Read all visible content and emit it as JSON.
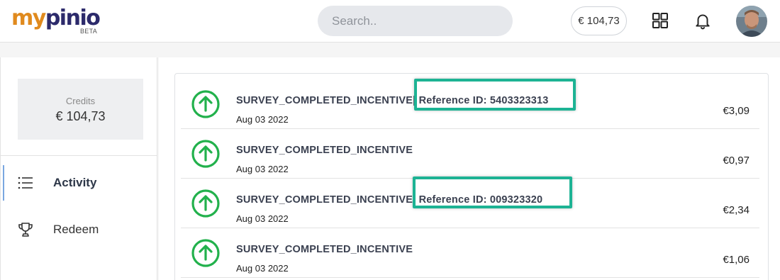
{
  "brand": {
    "logo_part1": "my",
    "logo_part2": "pinio",
    "badge": "BETA",
    "primary_color": "#e08a1e",
    "secondary_color": "#2c2a6b"
  },
  "header": {
    "search_placeholder": "Search..",
    "balance": "€ 104,73",
    "apps_icon": "grid-icon",
    "notifications_icon": "bell-icon",
    "avatar_icon": "user-avatar"
  },
  "sidebar": {
    "credits_label": "Credits",
    "credits_value": "€ 104,73",
    "items": [
      {
        "label": "Activity",
        "icon": "list-icon",
        "active": true
      },
      {
        "label": "Redeem",
        "icon": "trophy-icon",
        "active": false
      }
    ]
  },
  "transactions": [
    {
      "title": "SURVEY_COMPLETED_INCENTIVE",
      "reference": "| Reference ID: 5403323313",
      "date": "Aug 03 2022",
      "amount": "€3,09",
      "icon": "arrow-up-circle-icon"
    },
    {
      "title": "SURVEY_COMPLETED_INCENTIVE",
      "reference": "",
      "date": "Aug 03 2022",
      "amount": "€0,97",
      "icon": "arrow-up-circle-icon"
    },
    {
      "title": "SURVEY_COMPLETED_INCENTIVE",
      "reference": "| Reference ID: 009323320",
      "date": "Aug 03 2022",
      "amount": "€2,34",
      "icon": "arrow-up-circle-icon"
    },
    {
      "title": "SURVEY_COMPLETED_INCENTIVE",
      "reference": "",
      "date": "Aug 03 2022",
      "amount": "€1,06",
      "icon": "arrow-up-circle-icon"
    }
  ],
  "colors": {
    "income_green": "#22b14c",
    "highlight": "#1db394"
  }
}
